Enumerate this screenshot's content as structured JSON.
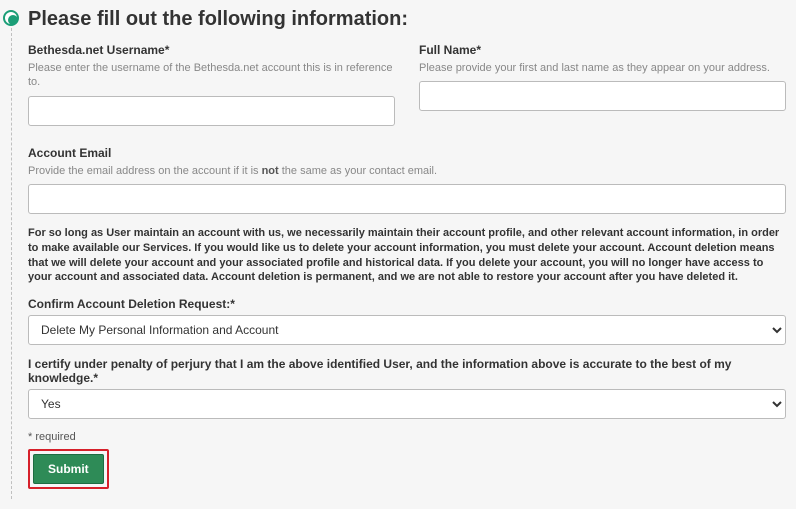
{
  "title": "Please fill out the following information:",
  "username": {
    "label": "Bethesda.net Username*",
    "help": "Please enter the username of the Bethesda.net account this is in reference to.",
    "value": ""
  },
  "fullname": {
    "label": "Full Name*",
    "help": "Please provide your first and last name as they appear on your address.",
    "value": ""
  },
  "email": {
    "label": "Account Email",
    "help_pre": "Provide the email address on the account if it is ",
    "help_bold": "not",
    "help_post": " the same as your contact email.",
    "value": ""
  },
  "notice": "For so long as User maintain an account with us, we necessarily maintain their account profile, and other relevant account information, in order to make available our Services. If you would like us to delete your account information, you must delete your account. Account deletion means that we will delete your account and your associated profile and historical data. If you delete your account, you will no longer have access to your account and associated data. Account deletion is permanent, and we are not able to restore your account after you have deleted it.",
  "confirm": {
    "label": "Confirm Account Deletion Request:*",
    "value": "Delete My Personal Information and Account"
  },
  "certify": {
    "label": "I certify under penalty of perjury that I am the above identified User, and the information above is accurate to the best of my knowledge.*",
    "value": "Yes"
  },
  "required_note": "* required",
  "submit_label": "Submit"
}
